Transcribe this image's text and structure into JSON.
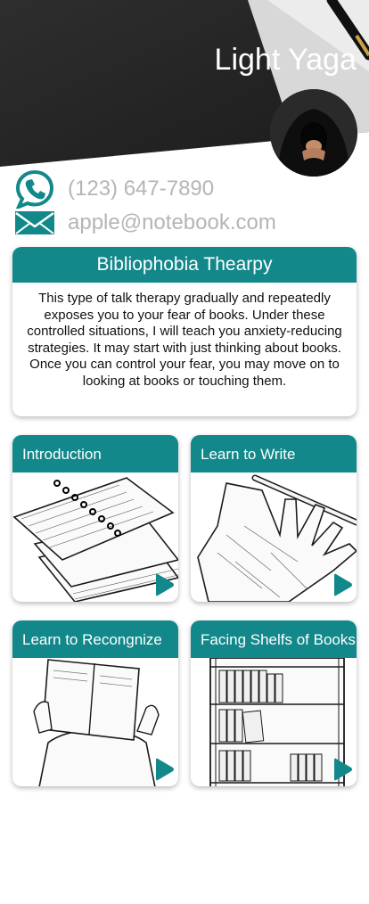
{
  "profile": {
    "name": "Light Yaga"
  },
  "contact": {
    "phone": "(123) 647-7890",
    "email": "apple@notebook.com"
  },
  "about": {
    "title": "Bibliophobia Thearpy",
    "body": "This type of talk therapy gradually and repeatedly exposes you to your fear of books. Under these controlled situations, I will teach you anxiety-reducing strategies. It may start with just thinking about books. Once you can control your fear, you may move on to looking at books or touching them."
  },
  "tiles": [
    {
      "title": "Introduction",
      "art": "notebook-sketch"
    },
    {
      "title": "Learn to Write",
      "art": "hand-pen-sketch"
    },
    {
      "title": "Learn to Recongnize",
      "art": "reader-sketch"
    },
    {
      "title": "Facing Shelfs of Books",
      "art": "bookshelf-sketch"
    }
  ],
  "colors": {
    "accent": "#12888a",
    "header_dark": "#262626",
    "muted_text": "#b5b5b5"
  }
}
